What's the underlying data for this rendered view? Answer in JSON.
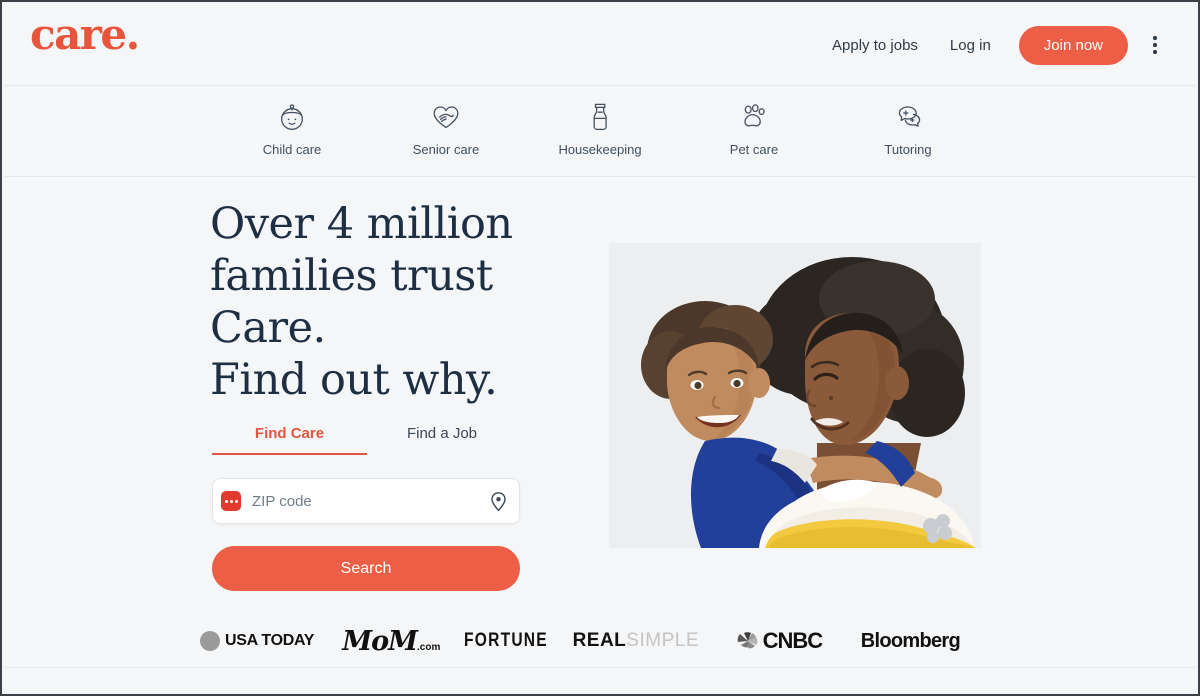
{
  "site": {
    "logo_text": "care",
    "logo_dot": "."
  },
  "header": {
    "apply_label": "Apply to jobs",
    "login_label": "Log in",
    "join_label": "Join now",
    "overflow_menu_name": "more-options"
  },
  "categories": [
    {
      "label": "Child care",
      "icon": "baby-face-icon"
    },
    {
      "label": "Senior care",
      "icon": "heart-hands-icon"
    },
    {
      "label": "Housekeeping",
      "icon": "spray-bottle-icon"
    },
    {
      "label": "Pet care",
      "icon": "paw-print-icon"
    },
    {
      "label": "Tutoring",
      "icon": "chat-bubbles-plus-icon"
    }
  ],
  "hero": {
    "headline_lines": [
      "Over 4 million",
      "families trust",
      "Care.",
      "Find out why."
    ],
    "tabs": [
      {
        "label": "Find Care",
        "active": true
      },
      {
        "label": "Find a Job",
        "active": false
      }
    ],
    "zip": {
      "placeholder": "ZIP code",
      "value": "",
      "pin_icon": "location-pin-icon",
      "extension_badge_icon": "extension-badge-icon"
    },
    "search_label": "Search",
    "image_alt": "Woman carrying a smiling toddler on her back"
  },
  "press": [
    {
      "name": "USA TODAY",
      "text": "USA TODAY"
    },
    {
      "name": "MoM.com",
      "text": "MoM",
      "suffix": ".com"
    },
    {
      "name": "FORTUNE",
      "text": "FORTUNE"
    },
    {
      "name": "REAL SIMPLE",
      "text": "REAL",
      "suffix": "SIMPLE"
    },
    {
      "name": "CNBC",
      "text": "CNBC"
    },
    {
      "name": "Bloomberg",
      "text": "Bloomberg"
    }
  ],
  "colors": {
    "brand_orange": "#ec5e46",
    "logo_orange": "#e8553c",
    "headline_navy": "#1e2f44",
    "page_bg": "#f5f6f7",
    "text_dark": "#2f3b47"
  }
}
